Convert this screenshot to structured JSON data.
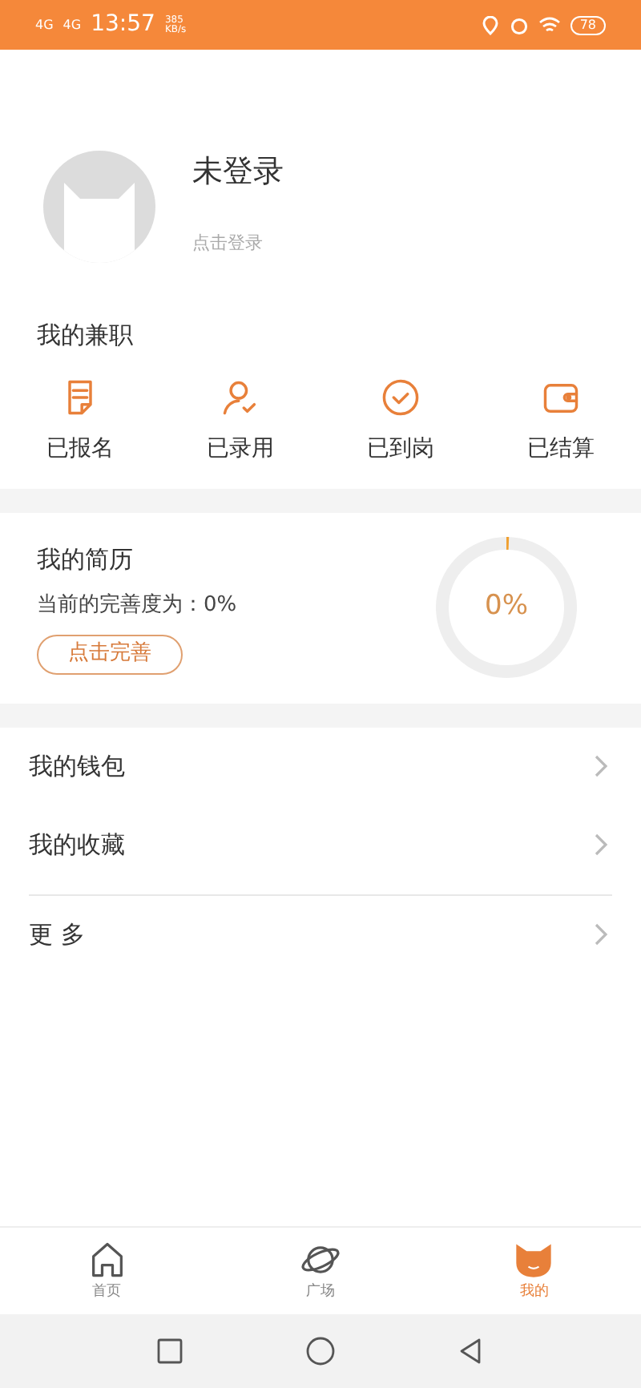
{
  "status_bar": {
    "network_1": "4G",
    "network_2": "4G",
    "time": "13:57",
    "speed": "385",
    "speed_unit": "KB/s",
    "battery": "78"
  },
  "profile": {
    "name": "未登录",
    "login_hint": "点击登录"
  },
  "jobs": {
    "title": "我的兼职",
    "items": [
      {
        "kind": "document",
        "label": "已报名"
      },
      {
        "kind": "person",
        "label": "已录用"
      },
      {
        "kind": "check",
        "label": "已到岗"
      },
      {
        "kind": "wallet",
        "label": "已结算"
      }
    ]
  },
  "resume": {
    "title": "我的简历",
    "completion_text": "当前的完善度为：0%",
    "button": "点击完善",
    "ring_label": "0%",
    "level": 0
  },
  "menu": [
    {
      "label": "我的钱包"
    },
    {
      "label": "我的收藏"
    },
    {
      "label": "更 多"
    }
  ],
  "tabs": [
    {
      "kind": "home",
      "label": "首页",
      "selected": false
    },
    {
      "kind": "planet",
      "label": "广场",
      "selected": false
    },
    {
      "kind": "cat",
      "label": "我的",
      "selected": true
    }
  ]
}
